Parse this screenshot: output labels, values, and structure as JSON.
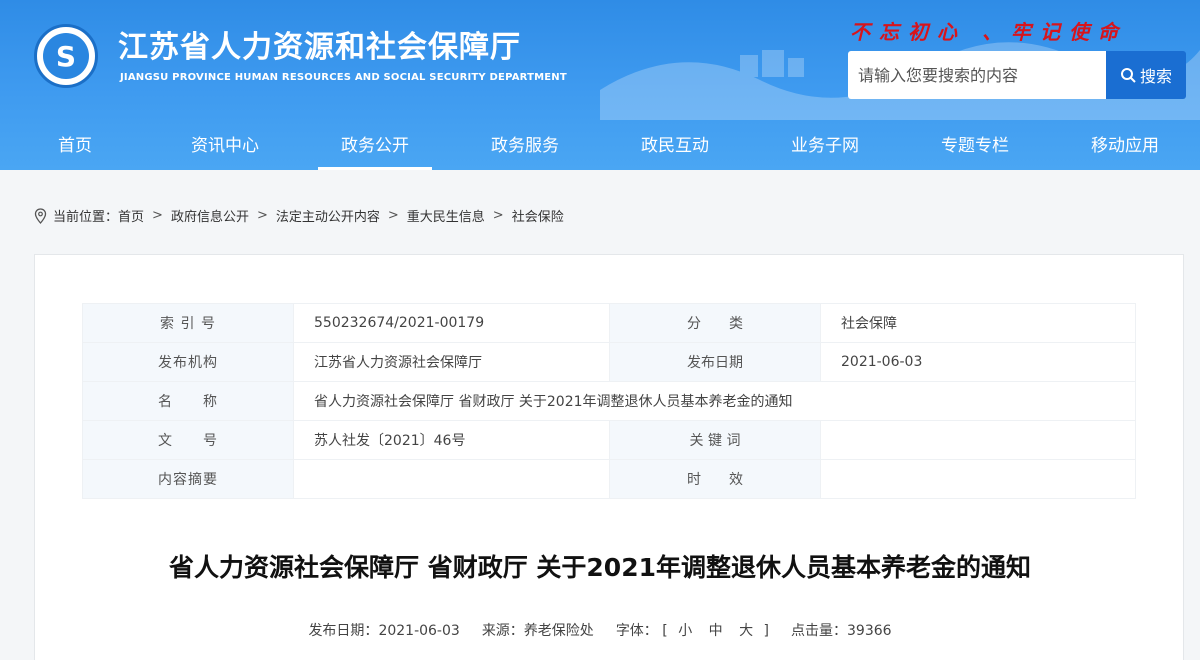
{
  "header": {
    "title": "江苏省人力资源和社会保障厅",
    "subtitle": "JIANGSU PROVINCE HUMAN RESOURCES AND SOCIAL SECURITY DEPARTMENT",
    "slogan": "不忘初心 、牢记使命",
    "logo_char": "S",
    "search": {
      "placeholder": "请输入您要搜索的内容",
      "button_label": "搜索"
    },
    "colors": {
      "primary": "#2f8ce6",
      "button": "#1a6ed2",
      "slogan": "#d8141b"
    }
  },
  "nav": [
    {
      "label": "首页"
    },
    {
      "label": "资讯中心"
    },
    {
      "label": "政务公开"
    },
    {
      "label": "政务服务"
    },
    {
      "label": "政民互动"
    },
    {
      "label": "业务子网"
    },
    {
      "label": "专题专栏"
    },
    {
      "label": "移动应用"
    }
  ],
  "nav_active_index": 2,
  "breadcrumb": {
    "prefix": "当前位置：",
    "items": [
      "首页",
      "政府信息公开",
      "法定主动公开内容",
      "重大民生信息",
      "社会保险"
    ]
  },
  "meta": {
    "index_label": "索 引 号",
    "index_value": "550232674/2021-00179",
    "category_label": "分　　类",
    "category_value": "社会保障",
    "publisher_label": "发布机构",
    "publisher_value": "江苏省人力资源社会保障厅",
    "date_label": "发布日期",
    "date_value": "2021-06-03",
    "name_label": "名　　称",
    "name_value": "省人力资源社会保障厅 省财政厅 关于2021年调整退休人员基本养老金的通知",
    "docno_label": "文　　号",
    "docno_value": "苏人社发〔2021〕46号",
    "keywords_label": "关 键 词",
    "keywords_value": "",
    "abstract_label": "内容摘要",
    "abstract_value": "",
    "validity_label": "时　　效",
    "validity_value": ""
  },
  "doc": {
    "title": "省人力资源社会保障厅 省财政厅 关于2021年调整退休人员基本养老金的通知",
    "date_label": "发布日期：",
    "date": "2021-06-03",
    "source_label": "来源：",
    "source": "养老保险处",
    "font_label": "字体：",
    "font_open": "[",
    "font_small": "小",
    "font_mid": "中",
    "font_large": "大",
    "font_close": "]",
    "views_label": "点击量：",
    "views": "39366"
  }
}
